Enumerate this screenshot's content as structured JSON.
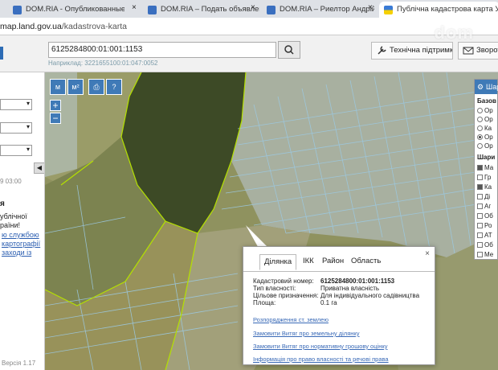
{
  "browser": {
    "tabs": [
      {
        "label": "DOM.RIA - Опубликованные о"
      },
      {
        "label": "DOM.RIA – Подать объявлени"
      },
      {
        "label": "DOM.RIA – Риелтор Андрій. У"
      },
      {
        "label": "Публічна кадастрова карта Ук"
      }
    ],
    "address_host": "map.land.gov.ua",
    "address_path": "/kadastrova-karta",
    "tab_close": "×"
  },
  "watermark": "dom",
  "header": {
    "search_value": "6125284800:01:001:1153",
    "search_hint": "Наприклад: 3221655100:01:047:0052",
    "support_label": "Технічна підтримка",
    "feedback_label": "Зворот"
  },
  "left_panel": {
    "time": "9 03:00",
    "heading": "я",
    "text1": "ублічної",
    "text2": "раїни!",
    "link1": "ю службою",
    "link2": "картографії",
    "link3": "заходи із",
    "version": "Версія 1.17"
  },
  "map": {
    "tools": {
      "measure": "м",
      "measure_area": "м²",
      "print": "⎙",
      "help": "?"
    },
    "zoom_in": "+",
    "zoom_out": "−",
    "layers": {
      "title": "Шар",
      "base_heading": "Базов",
      "base_options": [
        "Ор",
        "Ор",
        "Ка",
        "Ор",
        "Ор"
      ],
      "layers_heading": "Шари",
      "layer_items": [
        "Ма",
        "Гр",
        "Ка",
        "Ді",
        "Аг",
        "Об",
        "Ро",
        "АТ",
        "Об",
        "Ме"
      ]
    }
  },
  "popup": {
    "tabs": [
      "Ділянка",
      "ІКК",
      "Район",
      "Область"
    ],
    "close": "×",
    "fields": [
      {
        "label": "Кадастровий номер:",
        "value": "6125284800:01:001:1153"
      },
      {
        "label": "Тип власності:",
        "value": "Приватна власність"
      },
      {
        "label": "Цільове призначення:",
        "value": "Для індивідуального садівництва"
      },
      {
        "label": "Площа:",
        "value": "0.1 га"
      }
    ],
    "links": [
      "Розпорядження ст. землею",
      "Замовити Витяг про земельну ділянку",
      "Замовити Витяг про нормативну грошову оцінку",
      "Інформація про право власності та речові права"
    ]
  }
}
